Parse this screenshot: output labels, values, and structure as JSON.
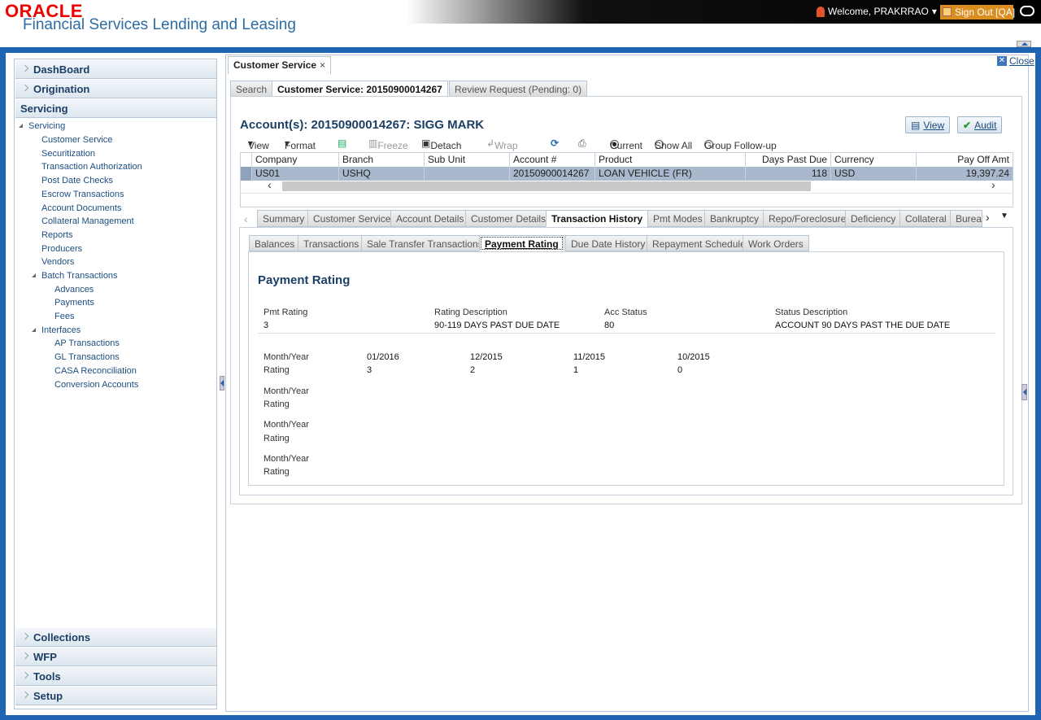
{
  "header": {
    "logo": "ORACLE",
    "product": "Financial Services Lending and Leasing",
    "welcome": "Welcome, PRAKRRAO",
    "signout": "Sign Out [QA]"
  },
  "left_nav": {
    "sections_top": [
      "DashBoard",
      "Origination",
      "Servicing"
    ],
    "tree": {
      "root": "Servicing",
      "items": [
        "Customer Service",
        "Securitization",
        "Transaction Authorization",
        "Post Date Checks",
        "Escrow Transactions",
        "Account Documents",
        "Collateral Management",
        "Reports",
        "Producers",
        "Vendors",
        "Batch Transactions",
        "Advances",
        "Payments",
        "Fees",
        "Interfaces",
        "AP Transactions",
        "GL Transactions",
        "CASA Reconciliation",
        "Conversion Accounts"
      ]
    },
    "sections_bottom": [
      "Collections",
      "WFP",
      "Tools",
      "Setup"
    ]
  },
  "doc_tab": {
    "label": "Customer Service",
    "close": "×"
  },
  "close_link": "Close",
  "sub_tabs": [
    "Search",
    "Customer Service: 20150900014267",
    "Review Request (Pending: 0)"
  ],
  "account_title": "Account(s): 20150900014267: SIGG MARK",
  "buttons": {
    "view": "View",
    "audit": "Audit"
  },
  "toolbar": {
    "view": "View",
    "format": "Format",
    "freeze": "Freeze",
    "detach": "Detach",
    "wrap": "Wrap",
    "current": "Current",
    "show_all": "Show All",
    "group": "Group Follow-up"
  },
  "grid": {
    "headers": [
      "Company",
      "Branch",
      "Sub Unit",
      "Account #",
      "Product",
      "Days Past Due",
      "Currency",
      "Pay Off Amt"
    ],
    "row": [
      "US01",
      "USHQ",
      "",
      "20150900014267",
      "LOAN VEHICLE (FR)",
      "118",
      "USD",
      "19,397.24"
    ]
  },
  "account_tabs": [
    "Summary",
    "Customer Service",
    "Account Details",
    "Customer Details",
    "Transaction History",
    "Pmt Modes",
    "Bankruptcy",
    "Repo/Foreclosure",
    "Deficiency",
    "Collateral",
    "Burea"
  ],
  "history_tabs": [
    "Balances",
    "Transactions",
    "Sale Transfer Transactions",
    "Payment Rating",
    "Due Date History",
    "Repayment Schedule",
    "Work Orders"
  ],
  "payment_rating": {
    "title": "Payment Rating",
    "labels": [
      "Pmt Rating",
      "Rating Description",
      "Acc Status",
      "Status Description"
    ],
    "values": [
      "3",
      "90-119 DAYS PAST DUE DATE",
      "80",
      "ACCOUNT 90 DAYS PAST THE DUE DATE"
    ],
    "month_label": "Month/Year",
    "rating_label": "Rating",
    "months": [
      "01/2016",
      "12/2015",
      "11/2015",
      "10/2015"
    ],
    "ratings": [
      "3",
      "2",
      "1",
      "0"
    ]
  }
}
